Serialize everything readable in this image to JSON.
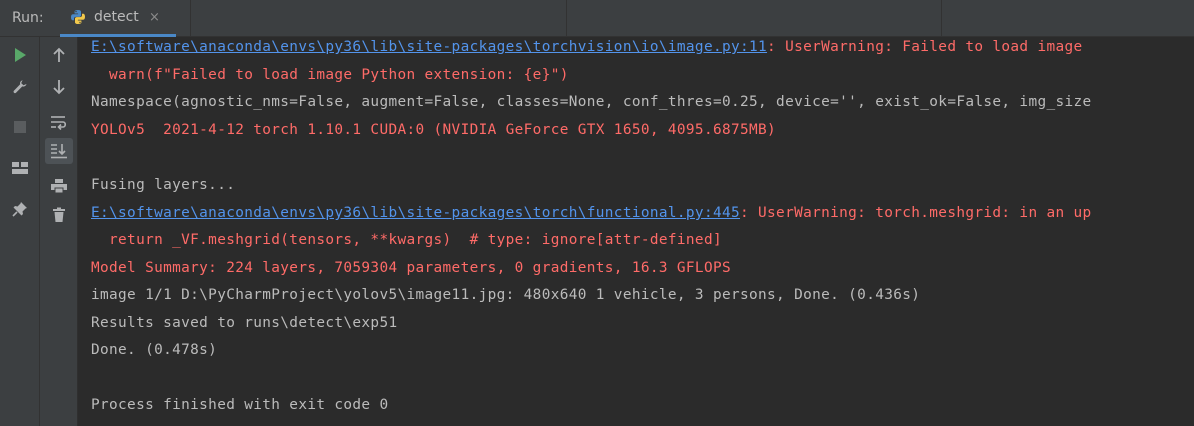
{
  "header": {
    "run_label": "Run:",
    "tab_title": "detect",
    "tab_close": "×"
  },
  "toolbar": {
    "left": [
      {
        "name": "run-icon"
      },
      {
        "name": "wrench-icon"
      },
      {
        "name": "stop-icon"
      },
      {
        "name": "layout-icon"
      },
      {
        "name": "pin-icon"
      }
    ],
    "right": [
      {
        "name": "arrow-up-icon"
      },
      {
        "name": "arrow-down-icon"
      },
      {
        "name": "soft-wrap-icon"
      },
      {
        "name": "scroll-to-end-icon"
      },
      {
        "name": "print-icon"
      },
      {
        "name": "trash-icon"
      }
    ]
  },
  "console": {
    "line1_link": "E:\\software\\anaconda\\envs\\py36\\lib\\site-packages\\torchvision\\io\\image.py:11",
    "line1_rest": ": UserWarning: Failed to load image",
    "line2": "  warn(f\"Failed to load image Python extension: {e}\")",
    "line3": "Namespace(agnostic_nms=False, augment=False, classes=None, conf_thres=0.25, device='', exist_ok=False, img_size",
    "line4": "YOLOv5  2021-4-12 torch 1.10.1 CUDA:0 (NVIDIA GeForce GTX 1650, 4095.6875MB)",
    "line5": "Fusing layers...",
    "line6_link": "E:\\software\\anaconda\\envs\\py36\\lib\\site-packages\\torch\\functional.py:445",
    "line6_rest": ": UserWarning: torch.meshgrid: in an up",
    "line7": "  return _VF.meshgrid(tensors, **kwargs)  # type: ignore[attr-defined]",
    "line8": "Model Summary: 224 layers, 7059304 parameters, 0 gradients, 16.3 GFLOPS",
    "line9": "image 1/1 D:\\PyCharmProject\\yolov5\\image11.jpg: 480x640 1 vehicle, 3 persons, Done. (0.436s)",
    "line10": "Results saved to runs\\detect\\exp51",
    "line11": "Done. (0.478s)",
    "line12": "Process finished with exit code 0"
  },
  "colors": {
    "background": "#2b2b2b",
    "panel": "#3c3f41",
    "text": "#bbbbbb",
    "error": "#ff6b68",
    "link": "#5394ec",
    "run_green": "#59a869",
    "tab_underline": "#4a88c7"
  }
}
